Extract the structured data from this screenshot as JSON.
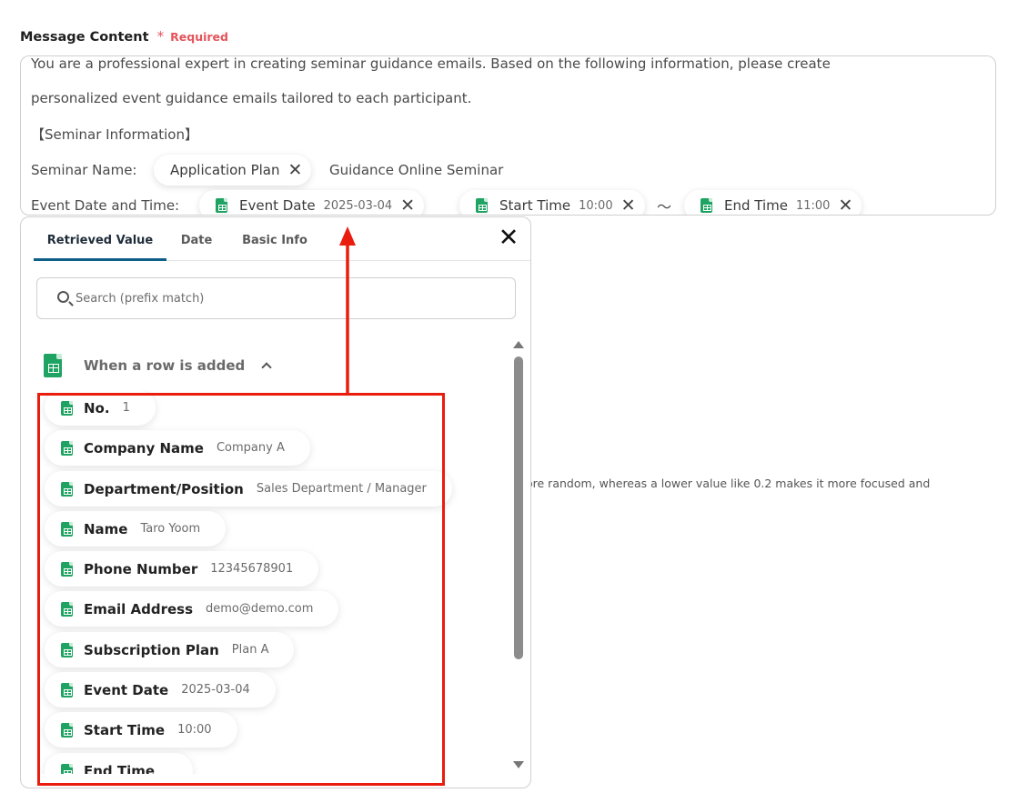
{
  "field": {
    "label": "Message Content",
    "required_star": "*",
    "required_text": "Required"
  },
  "editor": {
    "line1": "You are a professional expert in creating seminar guidance emails. Based on the following information, please create",
    "line2": "personalized event guidance emails tailored to each participant.",
    "line3": "【Seminar Information】",
    "seminar_name_label": "Seminar Name:",
    "seminar_name_chip": "Application Plan",
    "seminar_name_suffix": "Guidance Online Seminar",
    "event_date_label": "Event Date and Time:",
    "chips": [
      {
        "label": "Event Date",
        "value": "2025-03-04"
      },
      {
        "label": "Start Time",
        "value": "10:00"
      },
      {
        "label": "End Time",
        "value": "11:00"
      }
    ],
    "separator": "〜",
    "remove_glyph": "✕"
  },
  "background_text": "ore random, whereas a lower value like 0.2 makes it more focused and",
  "popup": {
    "tabs": [
      {
        "label": "Retrieved Value",
        "active": true
      },
      {
        "label": "Date",
        "active": false
      },
      {
        "label": "Basic Info",
        "active": false
      }
    ],
    "close_glyph": "✕",
    "search_placeholder": "Search (prefix match)",
    "section_title": "When a row is added",
    "items": [
      {
        "label": "No.",
        "value": "1"
      },
      {
        "label": "Company Name",
        "value": "Company A"
      },
      {
        "label": "Department/Position",
        "value": "Sales Department / Manager"
      },
      {
        "label": "Name",
        "value": "Taro Yoom"
      },
      {
        "label": "Phone Number",
        "value": "12345678901"
      },
      {
        "label": "Email Address",
        "value": "demo@demo.com"
      },
      {
        "label": "Subscription Plan",
        "value": "Plan A"
      },
      {
        "label": "Event Date",
        "value": "2025-03-04"
      },
      {
        "label": "Start Time",
        "value": "10:00"
      },
      {
        "label": "End Time",
        "value": ""
      }
    ]
  },
  "colors": {
    "accent_tab": "#0d5f87",
    "required": "#e5535b",
    "annotation_red": "#ea1c0d",
    "sheets_green": "#1ea362"
  },
  "icons": [
    "google-sheets-icon",
    "close-icon",
    "search-icon",
    "chevron-up-icon",
    "scroll-up-arrow-icon",
    "scroll-down-arrow-icon"
  ]
}
